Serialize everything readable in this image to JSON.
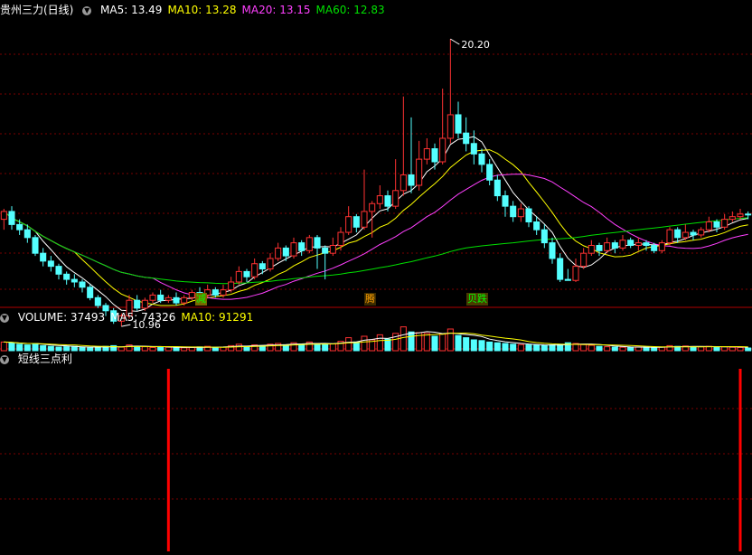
{
  "price_panel": {
    "stock_name": "贵州三力(日线)",
    "ma_legend": [
      {
        "label": "MA5: 13.49",
        "color": "#ffffff"
      },
      {
        "label": "MA10: 13.28",
        "color": "#ffff00"
      },
      {
        "label": "MA20: 13.15",
        "color": "#ff40ff"
      },
      {
        "label": "MA60: 12.83",
        "color": "#00e000"
      }
    ],
    "high_label": "20.20",
    "low_label": "10.96",
    "signals": [
      {
        "text": "减",
        "color": "#00ff00",
        "bg": "#7a6400"
      },
      {
        "text": "腾",
        "color": "#ffa000",
        "bg": "#3a2a00"
      },
      {
        "text": "贝跌",
        "color": "#00ff00",
        "bg": "#4a3a00"
      }
    ]
  },
  "volume_panel": {
    "legend": [
      {
        "label": "VOLUME: 37493",
        "color": "#ffffff"
      },
      {
        "label": "MA5: 74326",
        "color": "#ffffff"
      },
      {
        "label": "MA10: 91291",
        "color": "#ffff00"
      }
    ]
  },
  "indicator_panel": {
    "title": "短线三点利"
  },
  "colors": {
    "up": "#ff3232",
    "down": "#54ffff",
    "grid": "#7a0000",
    "ma5": "#ffffff",
    "ma10": "#ffff00",
    "ma20": "#ff40ff",
    "ma60": "#00e000",
    "bar": "#ff0000"
  },
  "chart_data": {
    "type": "candlestick",
    "title": "贵州三力(日线)",
    "ylim": [
      10.0,
      21.0
    ],
    "candles": [
      [
        13.3,
        13.6,
        13.7,
        12.9
      ],
      [
        13.6,
        13.1,
        13.8,
        12.9
      ],
      [
        13.1,
        12.9,
        13.3,
        12.7
      ],
      [
        12.9,
        12.6,
        13.1,
        12.4
      ],
      [
        12.6,
        12.0,
        12.7,
        11.9
      ],
      [
        12.0,
        11.7,
        12.2,
        11.5
      ],
      [
        11.7,
        11.5,
        11.9,
        11.3
      ],
      [
        11.5,
        11.2,
        11.6,
        11.0
      ],
      [
        11.2,
        11.0,
        11.3,
        10.8
      ],
      [
        11.0,
        10.9,
        11.2,
        10.7
      ],
      [
        10.9,
        10.7,
        11.0,
        10.5
      ],
      [
        10.7,
        10.3,
        10.8,
        10.2
      ],
      [
        10.3,
        10.0,
        10.4,
        9.9
      ],
      [
        10.0,
        9.8,
        10.1,
        9.6
      ],
      [
        9.8,
        9.4,
        9.9,
        9.3
      ],
      [
        9.4,
        9.6,
        9.7,
        9.2
      ],
      [
        9.6,
        10.2,
        10.4,
        9.5
      ],
      [
        10.2,
        9.9,
        10.4,
        9.8
      ],
      [
        9.9,
        10.2,
        10.3,
        9.8
      ],
      [
        10.2,
        10.4,
        10.5,
        10.1
      ],
      [
        10.4,
        10.2,
        10.6,
        10.1
      ],
      [
        10.2,
        10.3,
        10.4,
        10.1
      ],
      [
        10.3,
        10.1,
        10.5,
        10.0
      ],
      [
        10.1,
        10.3,
        10.4,
        10.0
      ],
      [
        10.3,
        10.5,
        10.6,
        10.2
      ],
      [
        10.5,
        10.4,
        10.7,
        10.3
      ],
      [
        10.4,
        10.6,
        10.8,
        10.3
      ],
      [
        10.6,
        10.4,
        10.7,
        10.3
      ],
      [
        10.4,
        10.6,
        10.8,
        10.3
      ],
      [
        10.6,
        10.9,
        11.1,
        10.5
      ],
      [
        10.9,
        11.3,
        11.5,
        10.8
      ],
      [
        11.3,
        11.1,
        11.4,
        10.9
      ],
      [
        11.1,
        11.6,
        11.8,
        11.0
      ],
      [
        11.6,
        11.4,
        11.7,
        11.2
      ],
      [
        11.4,
        11.8,
        12.0,
        11.3
      ],
      [
        11.8,
        12.2,
        12.4,
        11.7
      ],
      [
        12.2,
        11.9,
        12.3,
        11.7
      ],
      [
        11.9,
        12.4,
        12.6,
        11.8
      ],
      [
        12.4,
        12.1,
        12.5,
        11.9
      ],
      [
        12.1,
        12.6,
        12.7,
        12.0
      ],
      [
        12.6,
        12.2,
        12.7,
        11.4
      ],
      [
        12.2,
        12.0,
        12.3,
        11.0
      ],
      [
        12.0,
        12.3,
        12.6,
        11.9
      ],
      [
        12.3,
        12.8,
        13.0,
        12.1
      ],
      [
        12.8,
        13.4,
        13.8,
        12.7
      ],
      [
        13.4,
        13.0,
        13.5,
        12.8
      ],
      [
        13.0,
        13.6,
        15.2,
        12.9
      ],
      [
        13.6,
        13.9,
        14.0,
        12.6
      ],
      [
        13.9,
        14.2,
        14.6,
        13.7
      ],
      [
        14.2,
        13.8,
        14.4,
        13.6
      ],
      [
        13.8,
        14.4,
        15.6,
        13.7
      ],
      [
        14.4,
        15.0,
        18.0,
        14.2
      ],
      [
        15.0,
        14.6,
        17.2,
        14.3
      ],
      [
        14.6,
        15.6,
        16.3,
        14.4
      ],
      [
        15.6,
        16.0,
        16.4,
        15.4
      ],
      [
        16.0,
        15.5,
        16.2,
        15.2
      ],
      [
        15.5,
        16.4,
        18.3,
        15.4
      ],
      [
        16.4,
        17.3,
        20.2,
        16.2
      ],
      [
        17.3,
        16.6,
        17.8,
        16.4
      ],
      [
        16.6,
        16.2,
        17.2,
        15.9
      ],
      [
        16.2,
        15.8,
        16.7,
        15.4
      ],
      [
        15.8,
        15.4,
        16.0,
        15.1
      ],
      [
        15.4,
        14.8,
        15.6,
        14.6
      ],
      [
        14.8,
        14.2,
        15.0,
        14.0
      ],
      [
        14.2,
        13.8,
        14.4,
        13.4
      ],
      [
        13.8,
        13.4,
        14.0,
        13.2
      ],
      [
        13.4,
        13.7,
        13.9,
        13.2
      ],
      [
        13.7,
        13.2,
        13.8,
        13.0
      ],
      [
        13.2,
        12.9,
        13.4,
        12.7
      ],
      [
        12.9,
        12.4,
        13.1,
        12.2
      ],
      [
        12.4,
        11.8,
        12.6,
        11.6
      ],
      [
        11.8,
        11.0,
        12.0,
        10.9
      ],
      [
        11.0,
        10.96,
        11.4,
        10.96
      ],
      [
        10.96,
        11.5,
        11.8,
        10.9
      ],
      [
        11.5,
        12.0,
        12.2,
        11.4
      ],
      [
        12.0,
        12.3,
        12.5,
        11.9
      ],
      [
        12.3,
        12.1,
        12.4,
        11.9
      ],
      [
        12.1,
        12.4,
        12.6,
        12.0
      ],
      [
        12.4,
        12.2,
        12.5,
        12.0
      ],
      [
        12.2,
        12.5,
        12.7,
        12.1
      ],
      [
        12.5,
        12.3,
        12.6,
        12.2
      ],
      [
        12.3,
        12.4,
        12.6,
        12.1
      ],
      [
        12.4,
        12.3,
        12.5,
        12.1
      ],
      [
        12.3,
        12.1,
        12.4,
        12.0
      ],
      [
        12.1,
        12.4,
        12.5,
        12.0
      ],
      [
        12.4,
        12.9,
        13.0,
        12.3
      ],
      [
        12.9,
        12.6,
        13.0,
        12.4
      ],
      [
        12.6,
        12.8,
        13.1,
        12.5
      ],
      [
        12.8,
        12.7,
        12.9,
        12.5
      ],
      [
        12.7,
        12.9,
        13.0,
        12.6
      ],
      [
        12.9,
        13.2,
        13.4,
        12.8
      ],
      [
        13.2,
        13.0,
        13.3,
        12.8
      ],
      [
        13.0,
        13.3,
        13.5,
        12.9
      ],
      [
        13.3,
        13.4,
        13.6,
        13.2
      ],
      [
        13.4,
        13.5,
        13.7,
        13.3
      ],
      [
        13.5,
        13.49,
        13.6,
        13.3
      ]
    ],
    "ma_lines": [
      "MA5",
      "MA10",
      "MA20",
      "MA60"
    ],
    "volume": {
      "ylim": [
        0,
        400000
      ],
      "values": [
        120000,
        110000,
        90000,
        80000,
        100000,
        70000,
        60000,
        50000,
        55000,
        60000,
        45000,
        40000,
        50000,
        60000,
        70000,
        50000,
        80000,
        60000,
        55000,
        45000,
        50000,
        48000,
        42000,
        40000,
        45000,
        52000,
        60000,
        48000,
        50000,
        70000,
        90000,
        60000,
        80000,
        70000,
        90000,
        100000,
        80000,
        110000,
        90000,
        120000,
        100000,
        85000,
        95000,
        130000,
        180000,
        120000,
        200000,
        150000,
        220000,
        160000,
        240000,
        330000,
        260000,
        250000,
        240000,
        200000,
        230000,
        300000,
        210000,
        180000,
        150000,
        140000,
        120000,
        110000,
        100000,
        90000,
        85000,
        80000,
        75000,
        70000,
        80000,
        90000,
        110000,
        100000,
        85000,
        75000,
        60000,
        55000,
        50000,
        48000,
        45000,
        52000,
        48000,
        45000,
        50000,
        70000,
        60000,
        65000,
        50000,
        55000,
        60000,
        50000,
        55000,
        48000,
        45000,
        37493
      ]
    },
    "indicator": {
      "name": "短线三点利",
      "bars_at_index": [
        21,
        94
      ]
    }
  }
}
